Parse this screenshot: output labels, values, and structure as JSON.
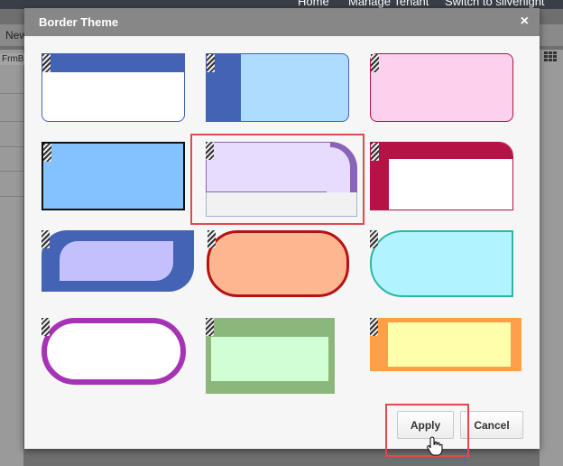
{
  "background": {
    "top_nav": [
      "Home",
      "Manage Tenant",
      "Switch to silverlight"
    ],
    "tab_label": "New",
    "breadcrumb": "FrmBo"
  },
  "dialog": {
    "title": "Border Theme",
    "close_symbol": "×",
    "themes": [
      {
        "name": "blue-header-rounded",
        "colors": [
          "#4363b4",
          "#ffffff"
        ]
      },
      {
        "name": "blue-sidebar-light-blue",
        "colors": [
          "#4363b4",
          "#aedcfe"
        ]
      },
      {
        "name": "pink-rounded",
        "colors": [
          "#b51245",
          "#fdd1ed"
        ]
      },
      {
        "name": "black-border-sky",
        "colors": [
          "#111111",
          "#84c2fe"
        ]
      },
      {
        "name": "lavender-curved",
        "colors": [
          "#8a64b9",
          "#e8dcfe"
        ],
        "selected": true
      },
      {
        "name": "crimson-l-frame",
        "colors": [
          "#b51245",
          "#ffffff"
        ]
      },
      {
        "name": "blue-leaf-lilac",
        "colors": [
          "#4363b4",
          "#c4c0fe"
        ]
      },
      {
        "name": "red-pill-peach",
        "colors": [
          "#b51212",
          "#fdb68f"
        ]
      },
      {
        "name": "teal-half-pill",
        "colors": [
          "#2cb7a4",
          "#b1f3fe"
        ]
      },
      {
        "name": "purple-pill-white",
        "colors": [
          "#a633b6",
          "#ffffff"
        ]
      },
      {
        "name": "green-frame-mint",
        "colors": [
          "#8cb77b",
          "#d2fed3"
        ]
      },
      {
        "name": "orange-frame-yellow",
        "colors": [
          "#fe9f49",
          "#fefeab"
        ]
      }
    ],
    "buttons": {
      "apply": "Apply",
      "cancel": "Cancel"
    }
  },
  "accent_colors": {
    "highlight": "#e24a4a",
    "header": "#878787"
  }
}
